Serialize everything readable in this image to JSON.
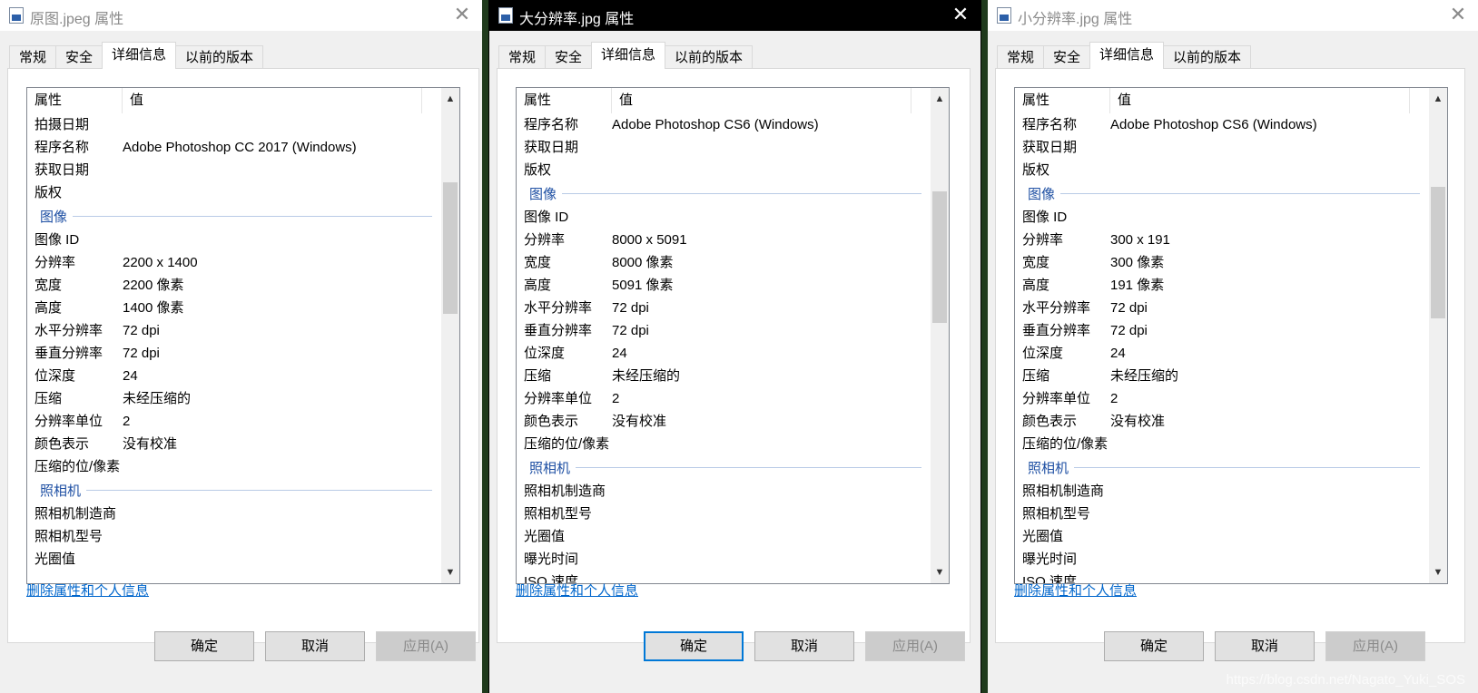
{
  "tabs": [
    "常规",
    "安全",
    "详细信息",
    "以前的版本"
  ],
  "header": {
    "col1": "属性",
    "col2": "值"
  },
  "remove_link": "删除属性和个人信息",
  "buttons": {
    "ok": "确定",
    "cancel": "取消",
    "apply": "应用(A)"
  },
  "watermark": "https://blog.csdn.net/Nagato_Yuki_SOS",
  "windows": [
    {
      "title": "原图.jpeg 属性",
      "scroll_thumb_fraction_start": 0.16,
      "scroll_thumb_fraction_size": 0.29,
      "rows": [
        {
          "k": "拍摄日期",
          "v": ""
        },
        {
          "k": "程序名称",
          "v": "Adobe Photoshop CC 2017 (Windows)"
        },
        {
          "k": "获取日期",
          "v": ""
        },
        {
          "k": "版权",
          "v": ""
        },
        {
          "group": "图像"
        },
        {
          "k": "图像 ID",
          "v": ""
        },
        {
          "k": "分辨率",
          "v": "2200 x 1400"
        },
        {
          "k": "宽度",
          "v": "2200 像素"
        },
        {
          "k": "高度",
          "v": "1400 像素"
        },
        {
          "k": "水平分辨率",
          "v": "72 dpi"
        },
        {
          "k": "垂直分辨率",
          "v": "72 dpi"
        },
        {
          "k": "位深度",
          "v": "24"
        },
        {
          "k": "压缩",
          "v": "未经压缩的"
        },
        {
          "k": "分辨率单位",
          "v": "2"
        },
        {
          "k": "颜色表示",
          "v": "没有校准"
        },
        {
          "k": "压缩的位/像素",
          "v": ""
        },
        {
          "group": "照相机"
        },
        {
          "k": "照相机制造商",
          "v": ""
        },
        {
          "k": "照相机型号",
          "v": ""
        },
        {
          "k": "光圈值",
          "v": ""
        }
      ]
    },
    {
      "title": "大分辨率.jpg 属性",
      "scroll_thumb_fraction_start": 0.18,
      "scroll_thumb_fraction_size": 0.29,
      "rows": [
        {
          "k": "程序名称",
          "v": "Adobe Photoshop CS6 (Windows)"
        },
        {
          "k": "获取日期",
          "v": ""
        },
        {
          "k": "版权",
          "v": ""
        },
        {
          "group": "图像"
        },
        {
          "k": "图像 ID",
          "v": ""
        },
        {
          "k": "分辨率",
          "v": "8000 x 5091"
        },
        {
          "k": "宽度",
          "v": "8000 像素"
        },
        {
          "k": "高度",
          "v": "5091 像素"
        },
        {
          "k": "水平分辨率",
          "v": "72 dpi"
        },
        {
          "k": "垂直分辨率",
          "v": "72 dpi"
        },
        {
          "k": "位深度",
          "v": "24"
        },
        {
          "k": "压缩",
          "v": "未经压缩的"
        },
        {
          "k": "分辨率单位",
          "v": "2"
        },
        {
          "k": "颜色表示",
          "v": "没有校准"
        },
        {
          "k": "压缩的位/像素",
          "v": ""
        },
        {
          "group": "照相机"
        },
        {
          "k": "照相机制造商",
          "v": ""
        },
        {
          "k": "照相机型号",
          "v": ""
        },
        {
          "k": "光圈值",
          "v": ""
        },
        {
          "k": "曝光时间",
          "v": ""
        },
        {
          "k": "ISO 速度",
          "v": ""
        }
      ]
    },
    {
      "title": "小分辨率.jpg 属性",
      "scroll_thumb_fraction_start": 0.17,
      "scroll_thumb_fraction_size": 0.29,
      "rows": [
        {
          "k": "程序名称",
          "v": "Adobe Photoshop CS6 (Windows)"
        },
        {
          "k": "获取日期",
          "v": ""
        },
        {
          "k": "版权",
          "v": ""
        },
        {
          "group": "图像"
        },
        {
          "k": "图像 ID",
          "v": ""
        },
        {
          "k": "分辨率",
          "v": "300 x 191"
        },
        {
          "k": "宽度",
          "v": "300 像素"
        },
        {
          "k": "高度",
          "v": "191 像素"
        },
        {
          "k": "水平分辨率",
          "v": "72 dpi"
        },
        {
          "k": "垂直分辨率",
          "v": "72 dpi"
        },
        {
          "k": "位深度",
          "v": "24"
        },
        {
          "k": "压缩",
          "v": "未经压缩的"
        },
        {
          "k": "分辨率单位",
          "v": "2"
        },
        {
          "k": "颜色表示",
          "v": "没有校准"
        },
        {
          "k": "压缩的位/像素",
          "v": ""
        },
        {
          "group": "照相机"
        },
        {
          "k": "照相机制造商",
          "v": ""
        },
        {
          "k": "照相机型号",
          "v": ""
        },
        {
          "k": "光圈值",
          "v": ""
        },
        {
          "k": "曝光时间",
          "v": ""
        },
        {
          "k": "ISO 速度",
          "v": ""
        }
      ]
    }
  ]
}
